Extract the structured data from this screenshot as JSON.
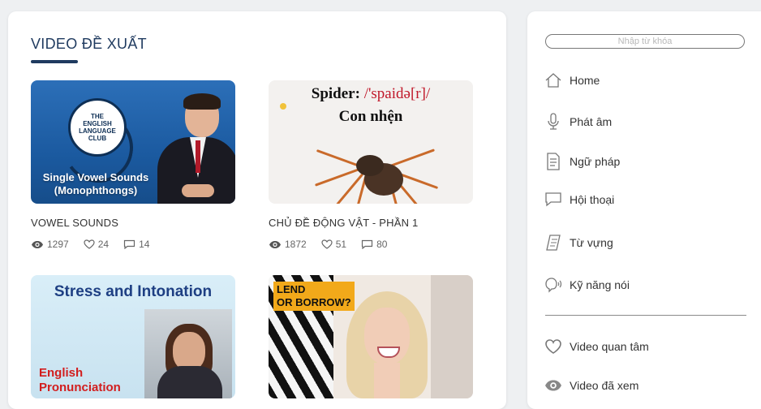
{
  "main": {
    "section_title": "VIDEO ĐỀ XUẤT",
    "videos": [
      {
        "title": "VOWEL SOUNDS",
        "views": "1297",
        "likes": "24",
        "comments": "14",
        "thumb_badge_line1": "THE",
        "thumb_badge_line2": "ENGLISH",
        "thumb_badge_line3": "LANGUAGE",
        "thumb_badge_line4": "CLUB",
        "thumb_caption_line1": "Single Vowel Sounds",
        "thumb_caption_line2": "(Monophthongs)"
      },
      {
        "title": "CHỦ ĐỀ ĐỘNG VẬT - PHẦN 1",
        "views": "1872",
        "likes": "51",
        "comments": "80",
        "thumb_word": "Spider: ",
        "thumb_ipa": "/'spaidə[r]/",
        "thumb_meaning": "Con nhện"
      },
      {
        "thumb_title": "Stress and Intonation",
        "thumb_caption_line1": "English",
        "thumb_caption_line2": "Pronunciation"
      },
      {
        "thumb_label_line1": "LEND",
        "thumb_label_line2": "OR BORROW?"
      }
    ]
  },
  "sidebar": {
    "search_placeholder": "Nhập từ khóa",
    "items": [
      {
        "label": "Home",
        "icon": "home-icon"
      },
      {
        "label": "Phát âm",
        "icon": "microphone-icon"
      },
      {
        "label": "Ngữ pháp",
        "icon": "document-icon"
      },
      {
        "label": "Hội thoại",
        "icon": "chat-bubble-icon"
      },
      {
        "label": "Từ vựng",
        "icon": "notebook-icon"
      },
      {
        "label": "Kỹ năng nói",
        "icon": "speaking-icon"
      }
    ],
    "secondary_items": [
      {
        "label": "Video quan tâm",
        "icon": "heart-icon"
      },
      {
        "label": "Video đã xem",
        "icon": "eye-icon"
      }
    ]
  },
  "colors": {
    "accent_navy": "#1f3a5f",
    "background": "#eef0f2",
    "card": "#ffffff"
  }
}
